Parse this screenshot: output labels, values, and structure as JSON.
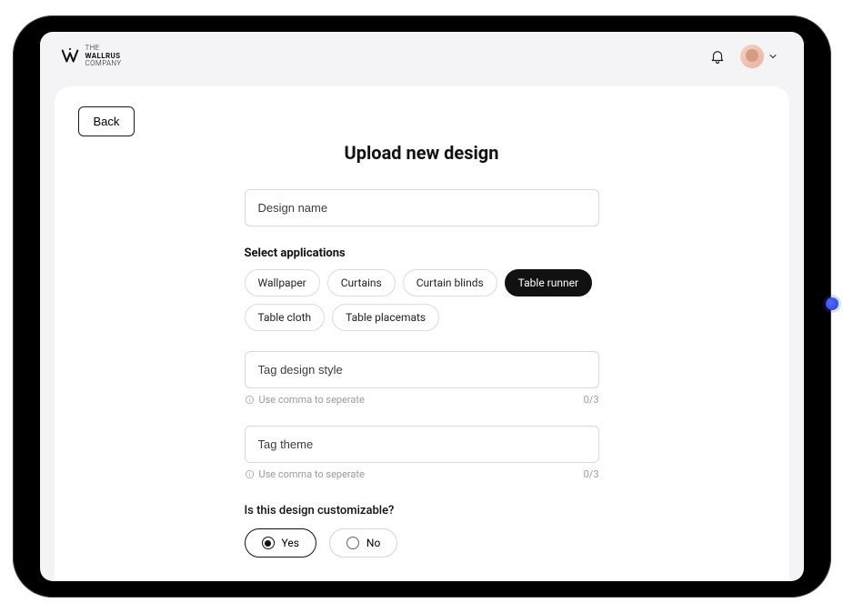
{
  "brand": {
    "line1": "THE",
    "line2": "WALLRUS",
    "line3": "COMPANY"
  },
  "back_label": "Back",
  "title": "Upload new design",
  "design_name_placeholder": "Design name",
  "select_apps_label": "Select applications",
  "applications": [
    {
      "label": "Wallpaper",
      "selected": false
    },
    {
      "label": "Curtains",
      "selected": false
    },
    {
      "label": "Curtain blinds",
      "selected": false
    },
    {
      "label": "Table runner",
      "selected": true
    },
    {
      "label": "Table cloth",
      "selected": false
    },
    {
      "label": "Table placemats",
      "selected": false
    }
  ],
  "tag_style_placeholder": "Tag design style",
  "tag_theme_placeholder": "Tag theme",
  "hint_text": "Use comma to seperate",
  "tag_style_counter": "0/3",
  "tag_theme_counter": "0/3",
  "customizable_question": "Is this design customizable?",
  "radio_yes": "Yes",
  "radio_no": "No",
  "radio_selected": "yes"
}
